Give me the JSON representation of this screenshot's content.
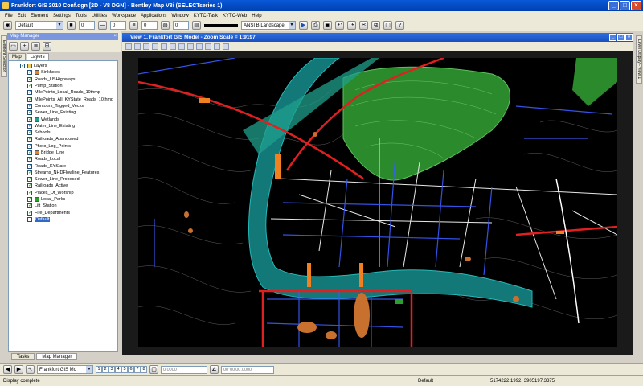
{
  "app": {
    "title": "Frankfort GIS 2010 Conf.dgn [2D - V8 DGN] - Bentley Map V8i (SELECTseries 1)"
  },
  "menu": [
    "File",
    "Edit",
    "Element",
    "Settings",
    "Tools",
    "Utilities",
    "Workspace",
    "Applications",
    "Window",
    "KYTC-Task",
    "KYTC-Web",
    "Help"
  ],
  "toolbar": {
    "level_value": "Default",
    "num_1": "0",
    "num_2": "0",
    "num_3": "0",
    "num_4": "0",
    "print_style": "ANSI B Landscape"
  },
  "map_manager": {
    "title": "Map Manager",
    "tabs": [
      "Map",
      "Layers"
    ],
    "root": "Layers",
    "layers": [
      {
        "name": "Sinkholes",
        "swatch": "#e8801e"
      },
      {
        "name": "Roads_USHighways",
        "swatch": null
      },
      {
        "name": "Pump_Station",
        "swatch": null
      },
      {
        "name": "MilePoints_Local_Roads_10thmp",
        "swatch": null
      },
      {
        "name": "MilePoints_All_KYState_Roads_10thmp",
        "swatch": null
      },
      {
        "name": "Contours_Tagged_Vector",
        "swatch": null
      },
      {
        "name": "Sewer_Line_Existing",
        "swatch": null
      },
      {
        "name": "Wetlands",
        "swatch": "#1f9f8c"
      },
      {
        "name": "Water_Line_Existing",
        "swatch": null
      },
      {
        "name": "Schools",
        "swatch": null
      },
      {
        "name": "Railroads_Abandoned",
        "swatch": null
      },
      {
        "name": "Photo_Log_Points",
        "swatch": null
      },
      {
        "name": "Bridge_Line",
        "swatch": "#e8801e"
      },
      {
        "name": "Roads_Local",
        "swatch": null
      },
      {
        "name": "Roads_KYState",
        "swatch": null
      },
      {
        "name": "Streams_NHDFlowline_Features",
        "swatch": null
      },
      {
        "name": "Sewer_Line_Proposed",
        "swatch": null
      },
      {
        "name": "Railroads_Active",
        "swatch": null
      },
      {
        "name": "Places_Of_Worship",
        "swatch": null
      },
      {
        "name": "Local_Parks",
        "swatch": "#2ca02c"
      },
      {
        "name": "Lift_Station",
        "swatch": null
      },
      {
        "name": "Fire_Departments",
        "swatch": null
      },
      {
        "name": "Default",
        "swatch": null,
        "selected": true
      }
    ],
    "bottom_tabs": [
      "Tasks",
      "Map Manager"
    ]
  },
  "side_tabs": {
    "left": "Element Selection",
    "right": "Level Display - View 1"
  },
  "view": {
    "title": "View 1, Frankfort GIS Model - Zoom Scale = 1:9197"
  },
  "statusbar": {
    "model_name": "Frankfort GIS Mo",
    "view_numbers": [
      "1",
      "2",
      "3",
      "4",
      "5",
      "6",
      "7",
      "8"
    ],
    "field1": "0.0000",
    "field2": "00\"00'00.0000",
    "message": "Display complete",
    "level": "Default",
    "coordinates": "5174222.1992, 3905197.3375"
  }
}
